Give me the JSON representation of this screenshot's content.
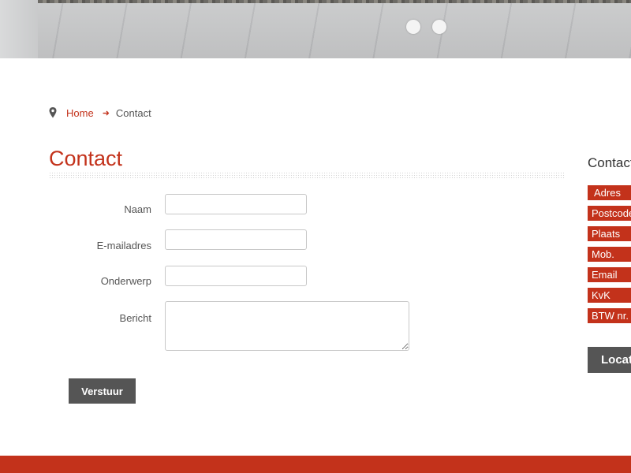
{
  "breadcrumb": {
    "home_label": "Home",
    "arrow_icon": "arrow-right-icon",
    "current_label": "Contact",
    "pin_icon": "map-pin-icon"
  },
  "page": {
    "title": "Contact"
  },
  "form": {
    "fields": [
      {
        "label": "Naam",
        "value": "",
        "placeholder": ""
      },
      {
        "label": "E-mailadres",
        "value": "",
        "placeholder": ""
      },
      {
        "label": "Onderwerp",
        "value": "",
        "placeholder": ""
      },
      {
        "label": "Bericht",
        "value": "",
        "placeholder": ""
      }
    ],
    "submit_label": "Verstuur"
  },
  "sidebar": {
    "title": "Contact",
    "info_labels": [
      "Adres",
      "Postcode",
      "Plaats",
      "Mob.",
      "Email",
      "KvK",
      "BTW nr."
    ],
    "location_button_label": "Locatie"
  },
  "slider": {
    "dots": 2
  },
  "colors": {
    "accent": "#c3321b",
    "button_dark": "#555555",
    "text": "#555555"
  }
}
